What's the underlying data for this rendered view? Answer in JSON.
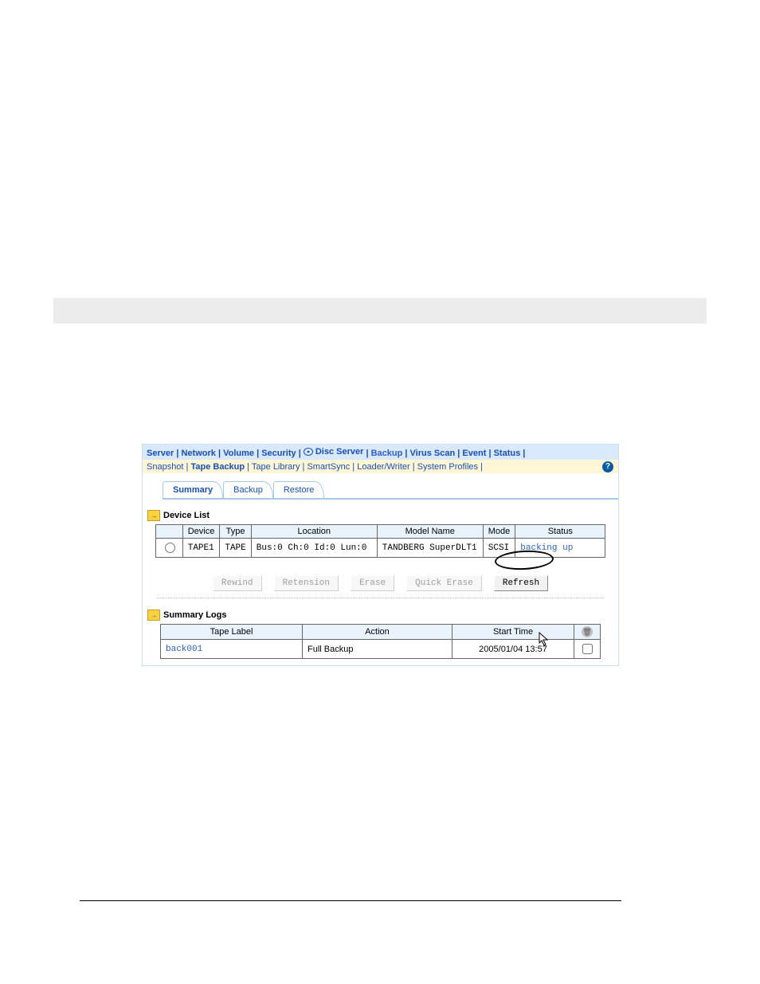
{
  "nav1": {
    "server": "Server",
    "network": "Network",
    "volume": "Volume",
    "security": "Security",
    "disc_server": "Disc Server",
    "backup": "Backup",
    "virus_scan": "Virus Scan",
    "event": "Event",
    "status": "Status"
  },
  "nav2": {
    "snapshot": "Snapshot",
    "tape_backup": "Tape Backup",
    "tape_library": "Tape Library",
    "smartsync": "SmartSync",
    "loader_writer": "Loader/Writer",
    "system_profiles": "System Profiles"
  },
  "tabs": {
    "summary": "Summary",
    "backup": "Backup",
    "restore": "Restore"
  },
  "sections": {
    "device_list": "Device List",
    "summary_logs": "Summary Logs"
  },
  "device_table": {
    "headers": {
      "device": "Device",
      "type": "Type",
      "location": "Location",
      "model": "Model Name",
      "mode": "Mode",
      "status": "Status"
    },
    "rows": [
      {
        "device": "TAPE1",
        "type": "TAPE",
        "location": "Bus:0 Ch:0 Id:0 Lun:0",
        "model": "TANDBERG SuperDLT1",
        "mode": "SCSI",
        "status": "backing up"
      }
    ]
  },
  "buttons": {
    "rewind": "Rewind",
    "retension": "Retension",
    "erase": "Erase",
    "quick_erase": "Quick Erase",
    "refresh": "Refresh"
  },
  "log_table": {
    "headers": {
      "tape_label": "Tape Label",
      "action": "Action",
      "start_time": "Start Time"
    },
    "rows": [
      {
        "tape_label": "back001",
        "action": "Full Backup",
        "start_time": "2005/01/04 13:57"
      }
    ]
  }
}
